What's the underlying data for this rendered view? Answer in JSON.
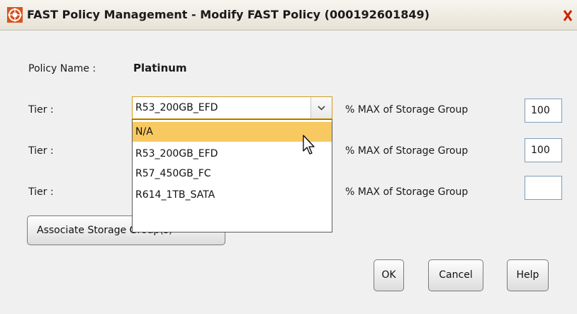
{
  "window": {
    "title": "FAST Policy Management - Modify FAST Policy (000192601849)",
    "app_icon": "emc-logo-icon",
    "close_icon": "close-icon"
  },
  "form": {
    "policy_name_label": "Policy Name :",
    "policy_name_value": "Platinum",
    "tiers": [
      {
        "label": "Tier :",
        "selected": "R53_200GB_EFD",
        "pct_label": "% MAX of Storage Group",
        "pct_value": "100"
      },
      {
        "label": "Tier :",
        "selected": "",
        "pct_label": "% MAX of Storage Group",
        "pct_value": "100"
      },
      {
        "label": "Tier :",
        "selected": "",
        "pct_label": "% MAX of Storage Group",
        "pct_value": ""
      }
    ]
  },
  "dropdown": {
    "open": true,
    "highlighted_index": 0,
    "options": [
      "N/A",
      "R53_200GB_EFD",
      "R57_450GB_FC",
      "R614_1TB_SATA"
    ]
  },
  "buttons": {
    "associate": "Associate Storage Group(s)",
    "ok": "OK",
    "cancel": "Cancel",
    "help": "Help"
  },
  "colors": {
    "focus_border": "#d59b1a",
    "highlight": "#f8c960",
    "close_icon": "#cc2200"
  }
}
